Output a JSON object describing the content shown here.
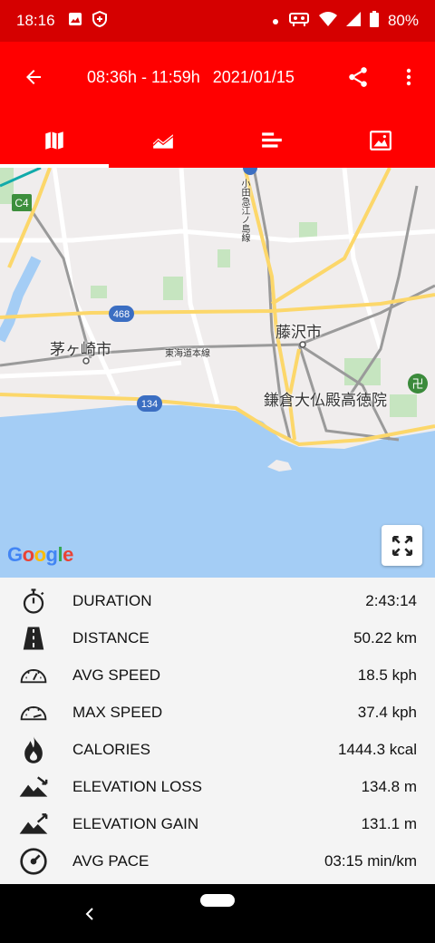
{
  "status_bar": {
    "time": "18:16",
    "battery": "80%",
    "icons": [
      "image-icon",
      "shield-icon",
      "dot-icon",
      "cast-icon",
      "wifi-icon",
      "signal-icon",
      "battery-icon"
    ]
  },
  "app_bar": {
    "time_range": "08:36h - 11:59h",
    "date": "2021/01/15"
  },
  "tabs": [
    {
      "name": "map-icon",
      "active": true
    },
    {
      "name": "chart-area-icon",
      "active": false
    },
    {
      "name": "bar-list-icon",
      "active": false
    },
    {
      "name": "photo-icon",
      "active": false
    }
  ],
  "map": {
    "labels": {
      "chigasaki": "茅ヶ崎市",
      "fujisawa": "藤沢市",
      "kamakura": "鎌倉大仏殿高徳院",
      "tokaido": "東海道本線",
      "odakyu": "小田急江ノ島線",
      "route468": "468",
      "route134": "134",
      "c4": "C4"
    },
    "logo": "Google"
  },
  "stats": [
    {
      "icon": "stopwatch-icon",
      "label": "DURATION",
      "value": "2:43:14"
    },
    {
      "icon": "road-icon",
      "label": "DISTANCE",
      "value": "50.22 km"
    },
    {
      "icon": "speedometer-icon",
      "label": "AVG SPEED",
      "value": "18.5 kph"
    },
    {
      "icon": "speedometer-max-icon",
      "label": "MAX SPEED",
      "value": "37.4 kph"
    },
    {
      "icon": "flame-icon",
      "label": "CALORIES",
      "value": "1444.3 kcal"
    },
    {
      "icon": "elevation-loss-icon",
      "label": "ELEVATION LOSS",
      "value": "134.8 m"
    },
    {
      "icon": "elevation-gain-icon",
      "label": "ELEVATION GAIN",
      "value": "131.1 m"
    },
    {
      "icon": "pace-gauge-icon",
      "label": "AVG PACE",
      "value": "03:15 min/km"
    }
  ]
}
